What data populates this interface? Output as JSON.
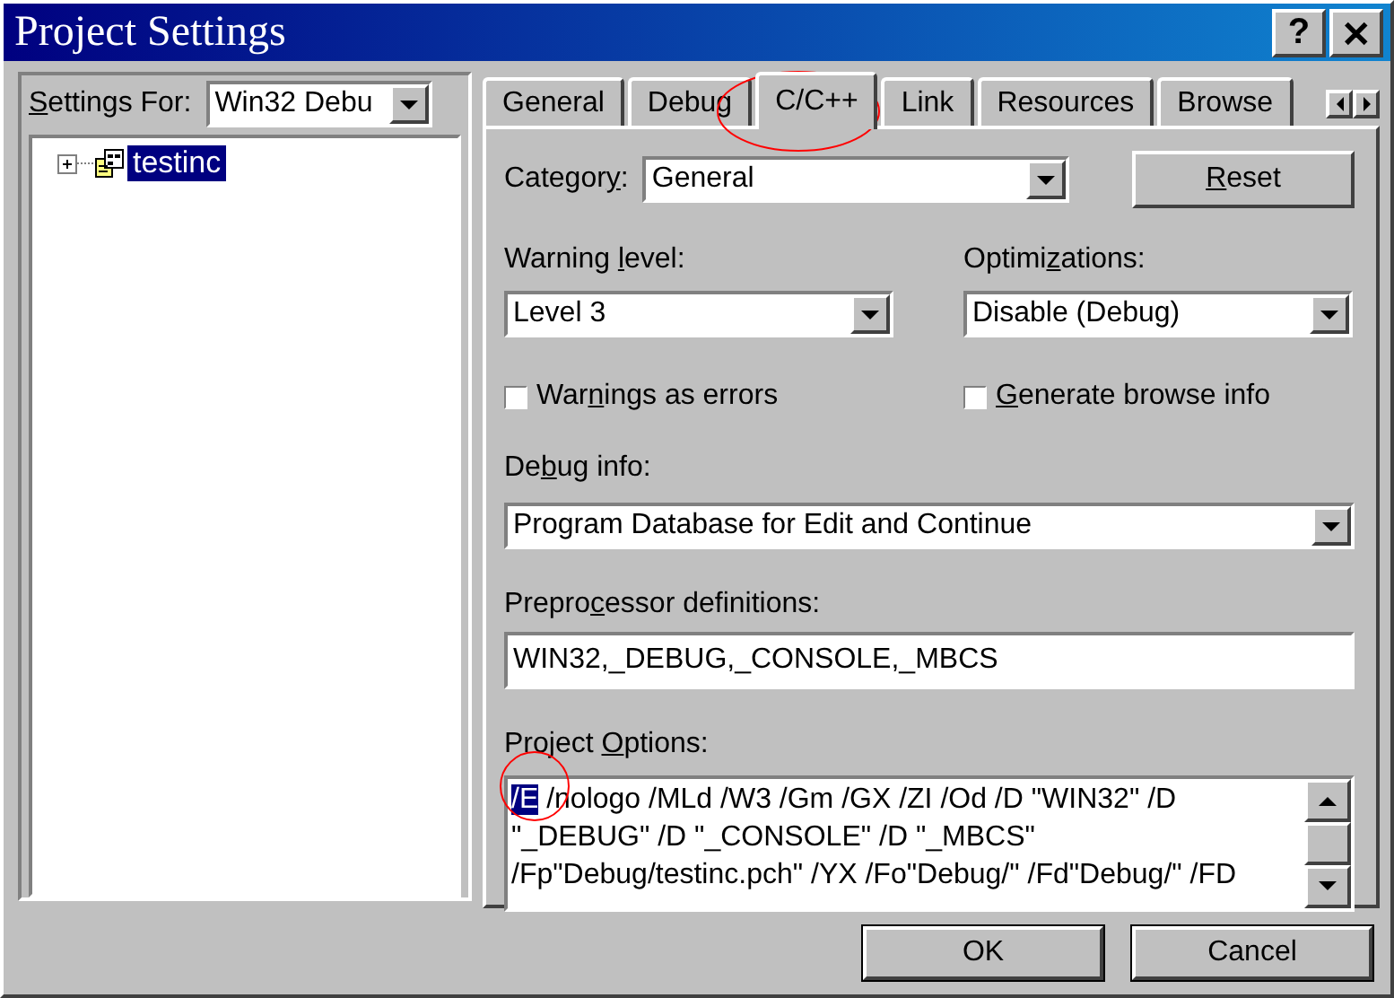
{
  "window": {
    "title": "Project Settings",
    "buttons": [
      "?",
      "✕"
    ]
  },
  "settings_for": {
    "label": [
      "S",
      "ettings For:"
    ],
    "value": "Win32 Debu"
  },
  "tree": [
    {
      "label": "testinc",
      "selected": true,
      "expanded": false
    }
  ],
  "tabs": [
    {
      "label": "General",
      "selected": false
    },
    {
      "label": "Debug",
      "selected": false
    },
    {
      "label": "C/C++",
      "selected": true
    },
    {
      "label": "Link",
      "selected": false
    },
    {
      "label": "Resources",
      "selected": false
    },
    {
      "label": "Browse",
      "selected": false
    }
  ],
  "category": {
    "label": [
      "Categor",
      "y",
      ":"
    ],
    "value": "General"
  },
  "reset_button": [
    "R",
    "eset"
  ],
  "warning_level": {
    "label": [
      "Warning ",
      "l",
      "evel:"
    ],
    "value": "Level 3"
  },
  "optimizations": {
    "label": [
      "Optimi",
      "z",
      "ations:"
    ],
    "value": "Disable (Debug)"
  },
  "checkboxes": [
    {
      "label": [
        "War",
        "n",
        "ings as errors"
      ],
      "checked": false
    },
    {
      "label": [
        "G",
        "enerate browse info"
      ],
      "checked": false
    }
  ],
  "debug_info": {
    "label": [
      "De",
      "b",
      "ug info:"
    ],
    "value": "Program Database for Edit and Continue"
  },
  "preprocessor": {
    "label": [
      "Prepro",
      "c",
      "essor definitions:"
    ],
    "value": "WIN32,_DEBUG,_CONSOLE,_MBCS"
  },
  "project_options": {
    "label": [
      "Project ",
      "O",
      "ptions:"
    ],
    "selected_text": "/E",
    "lines": [
      " /nologo /MLd /W3 /Gm /GX /ZI /Od /D \"WIN32\" /D",
      "\"_DEBUG\" /D \"_CONSOLE\" /D \"_MBCS\"",
      "/Fp\"Debug/testinc.pch\" /YX /Fo\"Debug/\" /Fd\"Debug/\" /FD"
    ]
  },
  "buttons": [
    "OK",
    "Cancel"
  ]
}
